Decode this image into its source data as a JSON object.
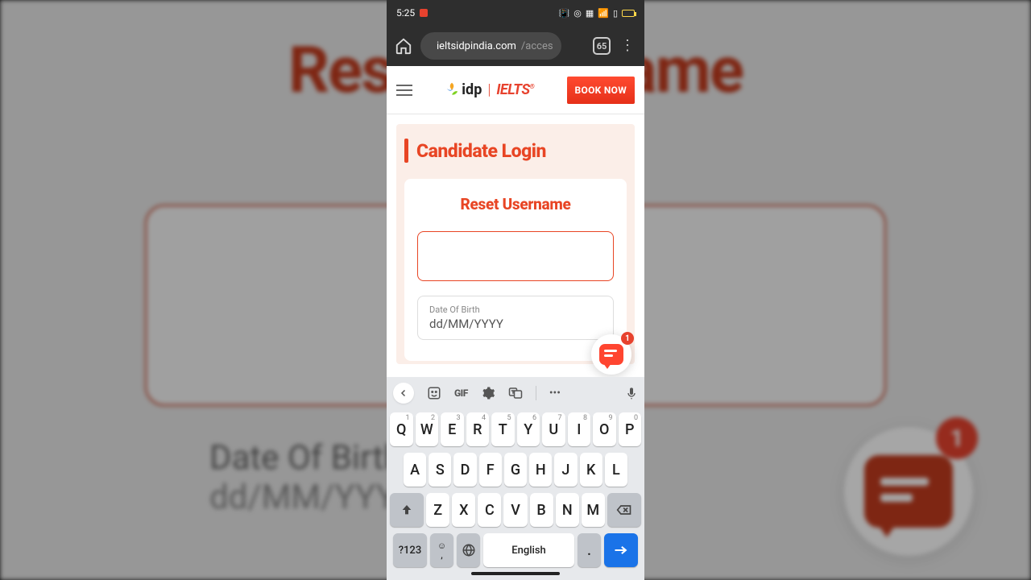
{
  "bg": {
    "title_partial": "Reset Username",
    "dob_label": "Date Of Birth",
    "dob_value": "dd/MM/YYYY",
    "badge": "1"
  },
  "status": {
    "time": "5:25"
  },
  "browser": {
    "domain": "ieltsidpindia.com",
    "path": "/acces",
    "tab_count": "65"
  },
  "header": {
    "logo_idp": "idp",
    "logo_ielts": "IELTS",
    "book_now": "BOOK NOW"
  },
  "page": {
    "login_title": "Candidate Login",
    "form_title": "Reset Username",
    "dob_label": "Date Of Birth",
    "dob_placeholder": "dd/MM/YYYY"
  },
  "chat": {
    "badge": "1"
  },
  "keyboard": {
    "gif": "GIF",
    "row1": [
      {
        "k": "Q",
        "s": "1"
      },
      {
        "k": "W",
        "s": "2"
      },
      {
        "k": "E",
        "s": "3"
      },
      {
        "k": "R",
        "s": "4"
      },
      {
        "k": "T",
        "s": "5"
      },
      {
        "k": "Y",
        "s": "6"
      },
      {
        "k": "U",
        "s": "7"
      },
      {
        "k": "I",
        "s": "8"
      },
      {
        "k": "O",
        "s": "9"
      },
      {
        "k": "P",
        "s": "0"
      }
    ],
    "row2": [
      "A",
      "S",
      "D",
      "F",
      "G",
      "H",
      "J",
      "K",
      "L"
    ],
    "row3": [
      "Z",
      "X",
      "C",
      "V",
      "B",
      "N",
      "M"
    ],
    "symkey": "?123",
    "space": "English",
    "period": "."
  }
}
